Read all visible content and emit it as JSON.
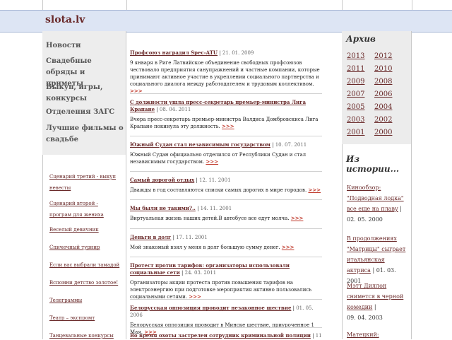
{
  "site": {
    "logo": "slota.lv"
  },
  "left_menu": [
    "Новости",
    "Свадебные обряды и приметы",
    "Выкуп, игры, конкурсы",
    "Отделения ЗАГС",
    "Лучшие фильмы о свадьбе"
  ],
  "left_links": [
    "Сценарий третий - выкуп невесты",
    "Сценарий второй - програм для жениха",
    "Веселый девичник",
    "Спичечный турнир",
    "Если вас выбрали тамадой",
    "Вспомни детство золотое!",
    "Телеграммы",
    "Театр – экспромт",
    "Танцевальные конкурсы"
  ],
  "archive": {
    "title": "Архив",
    "years": [
      "2013",
      "2012",
      "2011",
      "2010",
      "2009",
      "2008",
      "2007",
      "2006",
      "2005",
      "2004",
      "2003",
      "2002",
      "2001",
      "2000"
    ]
  },
  "history": {
    "title": "Из истории...",
    "items": [
      {
        "link": "Кинообзор: \"Подводная лодка\" все еще на плаву",
        "date": "02. 05. 2000"
      },
      {
        "link": "В продолжениях \"Матрицы\" сыграет итальянская актриса",
        "date": "01. 03. 2001"
      },
      {
        "link": "Мэтт Диллон снимется в черной комедии",
        "date": "09. 04. 2003"
      },
      {
        "link": "Матецкий:",
        "date": ""
      }
    ]
  },
  "news": [
    {
      "title": "Профсоюз наградил Spec-ATU",
      "date": "21. 01. 2009",
      "body": "9 января в Риге Латвийское объединение свободных профсоюзов чествовало предприятия санупражнений и частные компании, которые принимают активное участие в укреплении социального партнерства и социального диалога между работодателем и трудовым коллективом.",
      "more": ">>>"
    },
    {
      "title": "С должности ушла пресс-секретарь премьер-министра Лига Крапане",
      "date": "08. 04. 2011",
      "body": "Вчера пресс-секретарь премьер-министра Валдиса Домбровскиса Лига Крапане покинула эту должность.",
      "more": ">>>"
    },
    {
      "title": "Южный Судан стал независимым государством",
      "date": "10. 07. 2011",
      "body": "Южный Судан официально отделился от Республики Судан и стал независимым государством.",
      "more": ">>>"
    },
    {
      "title": "Самый дорогой отдых",
      "date": "12. 11. 2001",
      "body": "Дважды в год составляются списки самых дорогих в мире городов.",
      "more": ">>>"
    },
    {
      "title": "Мы были не такими?..",
      "date": "14. 11. 2001",
      "body": "Виртуальная жизнь наших детей.В автобусе все едут молча.",
      "more": ">>>"
    },
    {
      "title": "Деньги в долг",
      "date": "17. 11. 2001",
      "body": "Мой знакомый взял у меня в долг большую сумму денег.",
      "more": ">>>"
    },
    {
      "title": "Протест против тарифов: организаторы использовали социальные сети",
      "date": "24. 03. 2011",
      "body": "Организаторы акции протеста против повышения тарифов на электроэнергию при подготовке мероприятия активно пользовались социальными сетями.",
      "more": ">>>"
    },
    {
      "title": "Белорусская оппозиция проводит незаконное шествие",
      "date": "01. 05. 2006",
      "body": "Белорусская оппозиция проводит в Минске шествие, приуроченное 1 Мая.",
      "more": ">>>"
    },
    {
      "title": "Во время охоты застрелен сотрудник криминальной полиции",
      "date": "11. 10. 2010",
      "body": "",
      "more": ""
    }
  ]
}
